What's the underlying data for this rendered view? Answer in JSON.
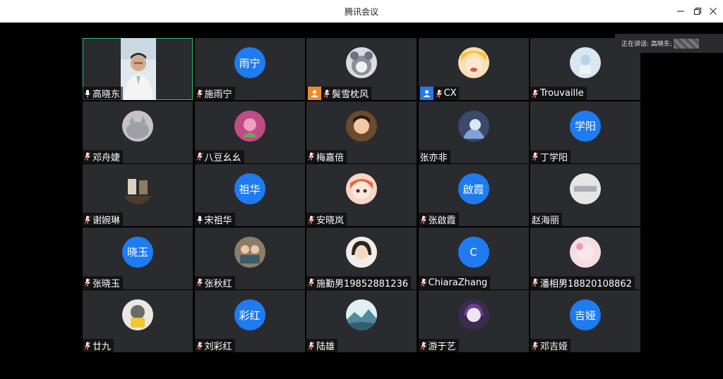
{
  "window": {
    "title": "腾讯会议",
    "controls": [
      "minimize",
      "restore",
      "close"
    ]
  },
  "speaking": {
    "label": "正在讲话: 高晓东;"
  },
  "participants": [
    {
      "name": "高晓东",
      "mic": "on",
      "avatar": "video",
      "active": true
    },
    {
      "name": "施雨宁",
      "mic": "muted",
      "avatar": "text",
      "avatar_text": "雨宁"
    },
    {
      "name": "鬓雪枕风",
      "mic": "muted",
      "avatar": "bear-photo",
      "badge": "host-orange"
    },
    {
      "name": "CX",
      "mic": "muted",
      "avatar": "anime-photo",
      "badge": "cohost-blue"
    },
    {
      "name": "Trouvaille",
      "mic": "muted",
      "avatar": "pastel-photo"
    },
    {
      "name": "邓舟婕",
      "mic": "muted",
      "avatar": "cat-photo"
    },
    {
      "name": "八豆幺幺",
      "mic": "muted",
      "avatar": "pink-art-photo"
    },
    {
      "name": "梅嘉倍",
      "mic": "muted",
      "avatar": "child-photo"
    },
    {
      "name": "张亦非",
      "mic": "none",
      "avatar": "blue-anime-photo"
    },
    {
      "name": "丁学阳",
      "mic": "muted",
      "avatar": "text",
      "avatar_text": "学阳"
    },
    {
      "name": "谢婉琳",
      "mic": "muted",
      "avatar": "room-photo"
    },
    {
      "name": "宋祖华",
      "mic": "on",
      "avatar": "text",
      "avatar_text": "祖华"
    },
    {
      "name": "安晓岚",
      "mic": "muted",
      "avatar": "cartoon-girl-photo"
    },
    {
      "name": "张啟霞",
      "mic": "muted",
      "avatar": "text",
      "avatar_text": "啟霞"
    },
    {
      "name": "赵海丽",
      "mic": "none",
      "avatar": "grey-photo"
    },
    {
      "name": "张晓玉",
      "mic": "muted",
      "avatar": "text",
      "avatar_text": "晓玉"
    },
    {
      "name": "张秋红",
      "mic": "muted",
      "avatar": "people-photo"
    },
    {
      "name": "施勤男19852881236",
      "mic": "muted",
      "avatar": "girl-photo"
    },
    {
      "name": "ChiaraZhang",
      "mic": "muted",
      "avatar": "text",
      "avatar_text": "C"
    },
    {
      "name": "潘相男18820108862",
      "mic": "muted",
      "avatar": "pink-face-photo"
    },
    {
      "name": "廿九",
      "mic": "muted",
      "avatar": "cat-yellow-photo"
    },
    {
      "name": "刘彩红",
      "mic": "muted",
      "avatar": "text",
      "avatar_text": "彩红"
    },
    {
      "name": "陆雄",
      "mic": "muted",
      "avatar": "landscape-photo"
    },
    {
      "name": "游于艺",
      "mic": "muted",
      "avatar": "purple-anime-photo"
    },
    {
      "name": "邓吉娅",
      "mic": "muted",
      "avatar": "text",
      "avatar_text": "吉娅"
    }
  ],
  "colors": {
    "tile_bg": "#2a2b2e",
    "avatar_blue": "#1f7bf0",
    "active_border": "#2fbf71",
    "host_orange": "#f08a24",
    "cohost_blue": "#1f7bf0"
  }
}
